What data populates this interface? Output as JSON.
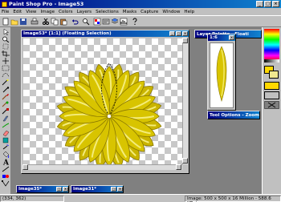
{
  "app": {
    "title": "Paint Shop Pro - Image53"
  },
  "menu": [
    "File",
    "Edit",
    "View",
    "Image",
    "Colors",
    "Layers",
    "Selections",
    "Masks",
    "Capture",
    "Window",
    "Help"
  ],
  "image_window": {
    "title": "Image53* [1:1] (Floating Selection)"
  },
  "layer_palette": {
    "title": "Layer Palette - Floati"
  },
  "layer_window": {
    "title": "1:6"
  },
  "tool_options": {
    "title": "Tool Options - Zoom"
  },
  "minimized": [
    {
      "title": "Image35*"
    },
    {
      "title": "Image31*"
    }
  ],
  "status": {
    "coords": "(334, 362)",
    "info": "Image:  500 x 500 x 16 Million - 588.6 KBytes"
  },
  "colors": {
    "title_active": "#000080",
    "flower_yellow": "#d8c400",
    "flower_dark": "#8a7800"
  }
}
